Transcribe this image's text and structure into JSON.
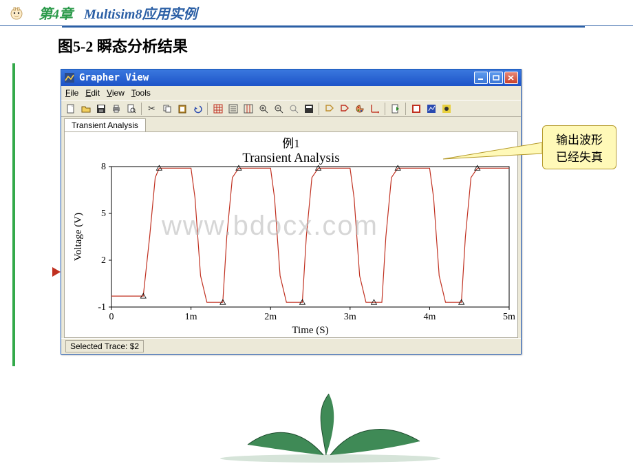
{
  "header": {
    "chapter": "第4章",
    "subject": "Multisim8应用实例"
  },
  "caption": "图5-2 瞬态分析结果",
  "callout": {
    "line1": "输出波形",
    "line2": "已经失真"
  },
  "watermark": "www.bdocx.com",
  "window": {
    "title": "Grapher View",
    "menu": [
      "File",
      "Edit",
      "View",
      "Tools"
    ],
    "tab": "Transient Analysis",
    "statusbar": "Selected Trace:  $2"
  },
  "chart_data": {
    "type": "line",
    "supertitle": "例1",
    "title": "Transient Analysis",
    "xlabel": "Time (S)",
    "ylabel": "Voltage (V)",
    "xlim": [
      0,
      0.005
    ],
    "ylim": [
      -1,
      8
    ],
    "xticks": [
      0,
      0.001,
      0.002,
      0.003,
      0.004,
      0.005
    ],
    "xtick_labels": [
      "0",
      "1m",
      "2m",
      "3m",
      "4m",
      "5m"
    ],
    "yticks": [
      -1,
      2,
      5,
      8
    ],
    "ytick_labels": [
      "-1",
      "2",
      "5",
      "8"
    ],
    "series": [
      {
        "name": "$2",
        "color": "#c03020",
        "x": [
          0,
          0.0004,
          0.00048,
          0.00055,
          0.0006,
          0.001,
          0.00105,
          0.00112,
          0.0012,
          0.0014,
          0.00145,
          0.00152,
          0.0016,
          0.002,
          0.00205,
          0.00212,
          0.0022,
          0.0024,
          0.00245,
          0.00252,
          0.0026,
          0.003,
          0.00305,
          0.00312,
          0.0032,
          0.0034,
          0.00345,
          0.00352,
          0.0036,
          0.004,
          0.00405,
          0.00412,
          0.0042,
          0.0044,
          0.00445,
          0.00452,
          0.0046,
          0.005
        ],
        "y": [
          -0.3,
          -0.3,
          3.5,
          7.3,
          7.9,
          7.9,
          6.0,
          1.0,
          -0.7,
          -0.7,
          3.5,
          7.3,
          7.9,
          7.9,
          6.0,
          1.0,
          -0.7,
          -0.7,
          3.5,
          7.3,
          7.9,
          7.9,
          6.0,
          1.0,
          -0.7,
          -0.7,
          3.5,
          7.3,
          7.9,
          7.9,
          6.0,
          1.0,
          -0.7,
          -0.7,
          3.5,
          7.3,
          7.9,
          7.9
        ]
      }
    ],
    "markers_x": [
      0.0004,
      0.0006,
      0.0014,
      0.0016,
      0.0024,
      0.0026,
      0.0033,
      0.0036,
      0.0044,
      0.0046
    ]
  }
}
